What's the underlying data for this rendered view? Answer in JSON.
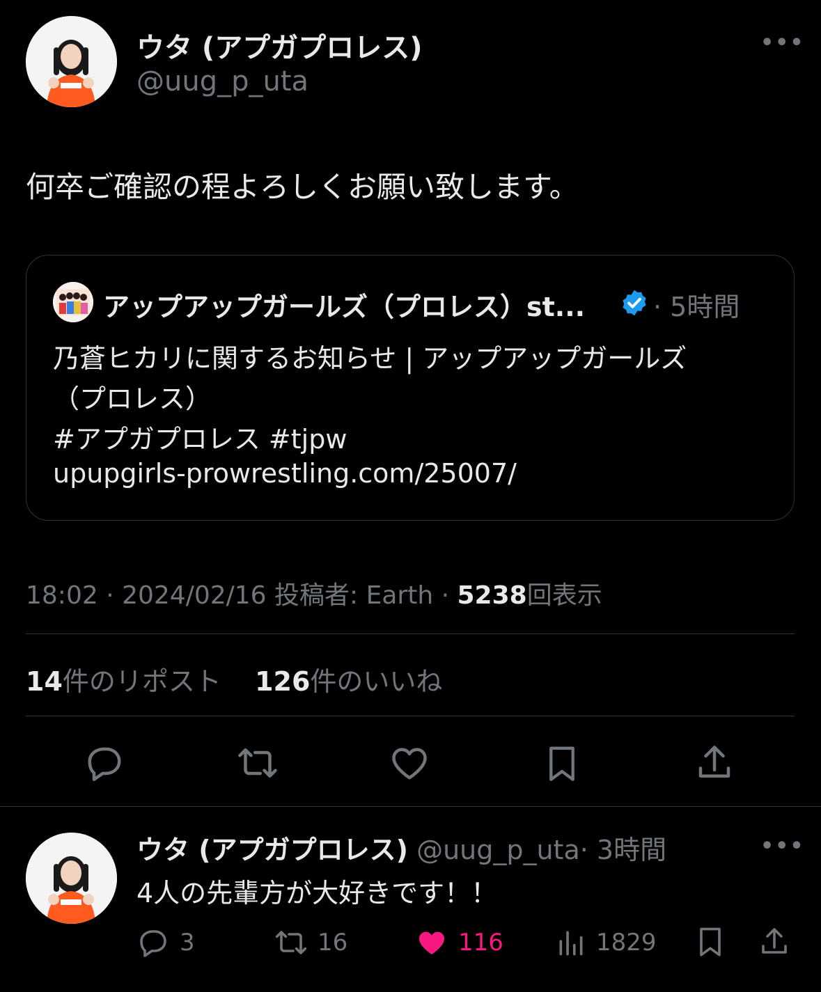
{
  "main_tweet": {
    "author_name": "ウタ (アプガプロレス)",
    "author_handle": "@uug_p_uta",
    "more_label": "•••",
    "text": "何卒ご確認の程よろしくお願い致します。",
    "quote": {
      "author_name": "アップアップガールズ（プロレス）st...",
      "verified_icon": "verified-badge-icon",
      "time": "· 5時間",
      "line1": "乃蒼ヒカリに関するお知らせ | アップアップガールズ",
      "line2": "（プロレス）",
      "line3": "#アプガプロレス #tjpw",
      "line4": "upupgirls-prowrestling.com/25007/"
    },
    "meta": {
      "time": "18:02 · 2024/02/16",
      "posted_by": "投稿者: Earth ·",
      "views_count": "5238",
      "views_label": "回表示"
    },
    "stats": {
      "reposts_count": "14",
      "reposts_label": "件のリポスト",
      "likes_count": "126",
      "likes_label": "件のいいね"
    },
    "actions": [
      "reply-icon",
      "repost-icon",
      "like-icon",
      "bookmark-icon",
      "share-icon"
    ]
  },
  "reply_tweet": {
    "author_name": "ウタ (アプガプロレス)",
    "author_handle": "@uug_p_uta",
    "time": "· 3時間",
    "more_label": "•••",
    "text": "4人の先輩方が大好きです！！",
    "reply_count": "3",
    "repost_count": "16",
    "like_count": "116",
    "views_count": "1829",
    "liked": true
  },
  "colors": {
    "background": "#000000",
    "text": "#e7e9ea",
    "muted": "#71767b",
    "border": "#2f3336",
    "verified": "#1d9bf0",
    "like": "#f91880"
  }
}
